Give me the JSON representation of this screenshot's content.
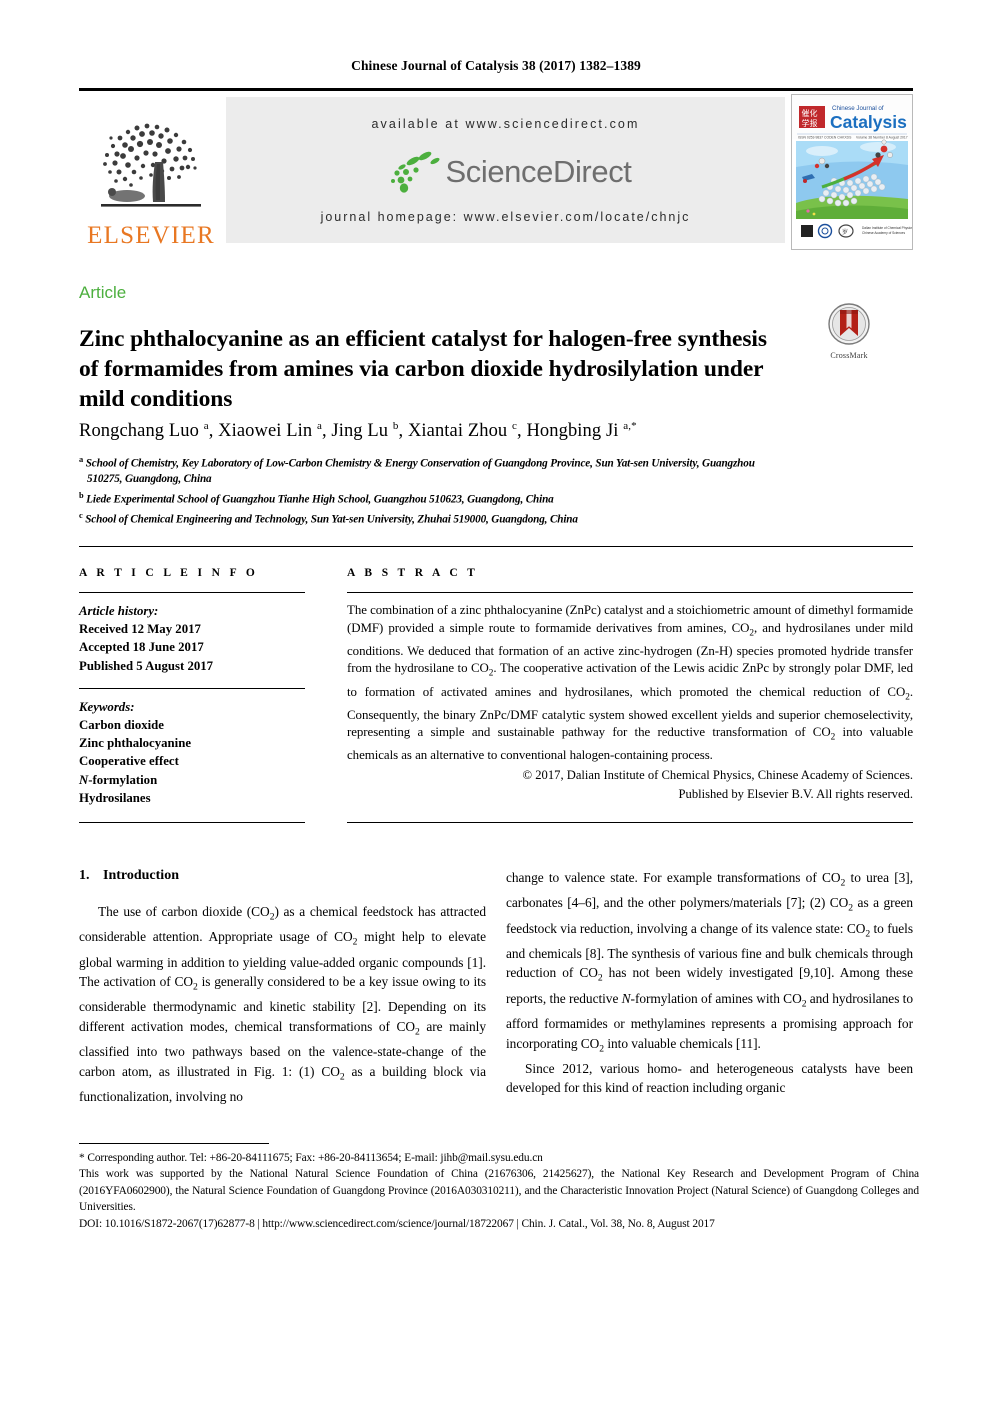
{
  "running_head": "Chinese Journal of Catalysis 38 (2017) 1382–1389",
  "masthead": {
    "publisher_logo_text": "ELSEVIER",
    "available_at": "available at www.sciencedirect.com",
    "sciencedirect_wordmark": "ScienceDirect",
    "journal_homepage": "journal homepage: www.elsevier.com/locate/chnjc",
    "cover_title_small": "Chinese Journal of",
    "cover_title_big": "Catalysis",
    "cover_issue_line": "Volume 38  Number 8  August  2017"
  },
  "article_type": "Article",
  "title": "Zinc phthalocyanine as an efficient catalyst for halogen-free synthesis of formamides from amines via carbon dioxide hydrosilylation under mild conditions",
  "crossmark_label": "CrossMark",
  "authors_plain": "Rongchang Luo a, Xiaowei Lin a, Jing Lu b, Xiantai Zhou c, Hongbing Ji a,*",
  "authors": [
    {
      "name": "Rongchang Luo",
      "marks": "a"
    },
    {
      "name": "Xiaowei Lin",
      "marks": "a"
    },
    {
      "name": "Jing Lu",
      "marks": "b"
    },
    {
      "name": "Xiantai Zhou",
      "marks": "c"
    },
    {
      "name": "Hongbing Ji",
      "marks": "a,*"
    }
  ],
  "affiliations": [
    {
      "mark": "a",
      "line1": "School of Chemistry, Key Laboratory of Low-Carbon Chemistry & Energy Conservation of Guangdong Province, Sun Yat-sen University, Guangzhou",
      "line2": "510275, Guangdong, China"
    },
    {
      "mark": "b",
      "line1": "Liede Experimental School of Guangzhou Tianhe High School, Guangzhou 510623, Guangdong, China",
      "line2": ""
    },
    {
      "mark": "c",
      "line1": "School of Chemical Engineering and Technology, Sun Yat-sen University, Zhuhai 519000, Guangdong, China",
      "line2": ""
    }
  ],
  "article_info": {
    "heading": "A R T I C L E   I N F O",
    "history_label": "Article history:",
    "received": "Received 12 May 2017",
    "accepted": "Accepted 18 June 2017",
    "published": "Published 5 August 2017",
    "keywords_label": "Keywords:",
    "keywords": [
      "Carbon dioxide",
      "Zinc phthalocyanine",
      "Cooperative effect",
      "N-formylation",
      "Hydrosilanes"
    ]
  },
  "abstract": {
    "heading": "A B S T R A C T",
    "paragraph_1": "The combination of a zinc phthalocyanine (ZnPc) catalyst and a stoichiometric amount of dimethyl formamide (DMF) provided a simple route to formamide derivatives from amines, CO",
    "paragraph_2": ", and hydrosilanes under mild conditions. We deduced that formation of an active zinc-hydrogen (Zn-H) species promoted hydride transfer from the hydrosilane to CO",
    "paragraph_3": ". The cooperative activation of the Lewis acidic ZnPc by strongly polar DMF, led to formation of activated amines and hydrosilanes, which promoted the chemical reduction of CO",
    "paragraph_4": ". Consequently, the binary ZnPc/DMF catalytic system showed excellent yields and superior chemoselectivity, representing a simple and sustainable pathway for the reductive transformation of CO",
    "paragraph_5": " into valuable chemicals as an alternative to conventional halogen-containing process.",
    "copyright_line_1": "© 2017, Dalian Institute of Chemical Physics, Chinese Academy of Sciences.",
    "copyright_line_2": "Published by Elsevier B.V. All rights reserved."
  },
  "body": {
    "section_number": "1.",
    "section_title": "Introduction",
    "left_p1_a": "The use of carbon dioxide (CO",
    "left_p1_b": ") as a chemical feedstock has attracted considerable attention. Appropriate usage of CO",
    "left_p1_c": " might help to elevate global warming in addition to yielding value-added organic compounds [1]. The activation of CO",
    "left_p1_d": " is generally considered to be a key issue owing to its considerable thermodynamic and kinetic stability [2]. Depending on its different activation modes, chemical transformations of CO",
    "left_p1_e": " are mainly classified into two pathways based on the valence-state-change of the carbon atom, as illustrated in Fig. 1: (1) CO",
    "left_p1_f": " as a building block via functionalization, involving no",
    "right_p1_a": "change to valence state. For example transformations of CO",
    "right_p1_b": " to urea [3], carbonates [4–6], and the other polymers/materials [7]; (2) CO",
    "right_p1_c": " as a green feedstock via reduction, involving a change of its valence state: CO",
    "right_p1_d": " to fuels and chemicals [8]. The synthesis of various fine and bulk chemicals through reduction of CO",
    "right_p1_e": " has not been widely investigated [9,10]. Among these reports, the reductive ",
    "right_p1_f": "N",
    "right_p1_g": "-formylation of amines with CO",
    "right_p1_h": " and hydrosilanes to afford formamides or methylamines represents a promising approach for incorporating CO",
    "right_p1_i": " into valuable chemicals [11].",
    "right_p2": "Since 2012, various homo- and heterogeneous catalysts have been developed for this kind of reaction including organic",
    "subscript_2": "2"
  },
  "footer": {
    "corresponding": "* Corresponding author. Tel: +86-20-84111675; Fax: +86-20-84113654; E-mail: jihb@mail.sysu.edu.cn",
    "funding": "This work was supported by the National Natural Science Foundation of China (21676306, 21425627), the National Key Research and Development Program of China (2016YFA0602900), the Natural Science Foundation of Guangdong Province (2016A030310211), and the Characteristic Innovation Project (Natural Science) of Guangdong Colleges and Universities.",
    "doi_line": "DOI: 10.1016/S1872-2067(17)62877-8 | http://www.sciencedirect.com/science/journal/18722067 | Chin. J. Catal., Vol. 38, No. 8, August 2017"
  },
  "colors": {
    "elsevier_orange": "#E87722",
    "article_green": "#4CAF3E",
    "sciencedirect_grey": "#6e6e6e",
    "banner_grey": "#ececec",
    "crossmark_red": "#B32017"
  }
}
